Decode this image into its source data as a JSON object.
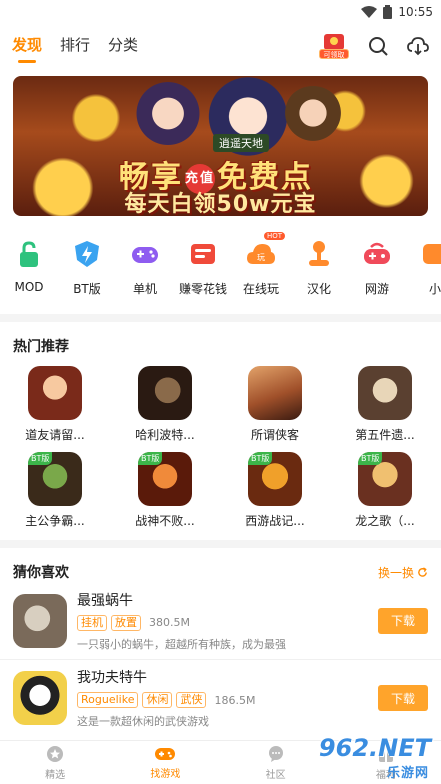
{
  "status": {
    "time": "10:55"
  },
  "nav": {
    "tabs": [
      {
        "label": "发现",
        "active": true
      },
      {
        "label": "排行",
        "active": false
      },
      {
        "label": "分类",
        "active": false
      }
    ],
    "gift_label": "可领取",
    "icons": [
      "search-icon",
      "download-icon"
    ]
  },
  "banner": {
    "plaque": "逍遥天地",
    "line1_a": "畅享",
    "line1_badge": "充值",
    "line1_b": "免费点",
    "line2": "每天白领50w元宝"
  },
  "categories": [
    {
      "label": "MOD",
      "icon": "lock-icon",
      "color": "#2ec27e"
    },
    {
      "label": "BT版",
      "icon": "lightning-shield-icon",
      "color": "#3aa3f0"
    },
    {
      "label": "单机",
      "icon": "gamepad-icon",
      "color": "#8e5cf0"
    },
    {
      "label": "赚零花钱",
      "icon": "wallet-icon",
      "color": "#f04a3a"
    },
    {
      "label": "在线玩",
      "icon": "cloud-play-icon",
      "color": "#ff8a2c",
      "badge": "HOT"
    },
    {
      "label": "汉化",
      "icon": "joystick-icon",
      "color": "#ff8a2c"
    },
    {
      "label": "网游",
      "icon": "controller-icon",
      "color": "#f04a5a"
    },
    {
      "label": "小",
      "icon": "partial-icon",
      "color": "#ff8a2c"
    }
  ],
  "hot": {
    "title": "热门推荐",
    "games": [
      {
        "name": "道友请留...",
        "bt": false,
        "colors": [
          "#f7c9a0",
          "#7a2a1a"
        ]
      },
      {
        "name": "哈利波特...",
        "bt": false,
        "colors": [
          "#6d4a2a",
          "#2a1a12"
        ]
      },
      {
        "name": "所谓侠客",
        "bt": false,
        "colors": [
          "#e3a36a",
          "#3a1a10"
        ]
      },
      {
        "name": "第五件遗...",
        "bt": false,
        "colors": [
          "#e8d6b8",
          "#5a4030"
        ]
      },
      {
        "name": "主公争霸...",
        "bt": true,
        "bt_label": "BT版",
        "colors": [
          "#7aa84a",
          "#3a2a1a"
        ]
      },
      {
        "name": "战神不败...",
        "bt": true,
        "bt_label": "BT版",
        "colors": [
          "#d9602a",
          "#5a1a0a"
        ]
      },
      {
        "name": "西游战记...",
        "bt": true,
        "bt_label": "BT版",
        "colors": [
          "#f0a02a",
          "#6a2a10"
        ]
      },
      {
        "name": "龙之歌（...",
        "bt": true,
        "bt_label": "BT版",
        "colors": [
          "#f0c070",
          "#6a3020"
        ]
      }
    ]
  },
  "guess": {
    "title": "猜你喜欢",
    "more": "换一换",
    "items": [
      {
        "name": "最强蜗牛",
        "tags": [
          "挂机",
          "放置"
        ],
        "size": "380.5M",
        "desc": "一只弱小的蜗牛，超越所有种族，成为最强",
        "button": "下载",
        "colors": [
          "#d8cfc0",
          "#7a6a5a"
        ]
      },
      {
        "name": "我功夫特牛",
        "tags": [
          "Roguelike",
          "休闲",
          "武侠"
        ],
        "size": "186.5M",
        "desc": "这是一款超休闲的武侠游戏",
        "button": "下载",
        "colors": [
          "#f2d04a",
          "#222222"
        ]
      }
    ]
  },
  "bottom": {
    "tabs": [
      {
        "label": "精选",
        "icon": "star-icon",
        "active": false
      },
      {
        "label": "找游戏",
        "icon": "gamepad-icon",
        "active": true
      },
      {
        "label": "社区",
        "icon": "chat-icon",
        "active": false
      },
      {
        "label": "福利",
        "icon": "gift-icon",
        "active": false
      }
    ]
  },
  "watermark": {
    "text": "962.NET",
    "sub": "乐游网"
  },
  "colors": {
    "accent": "#ff8a00",
    "button": "#ffa42b"
  }
}
